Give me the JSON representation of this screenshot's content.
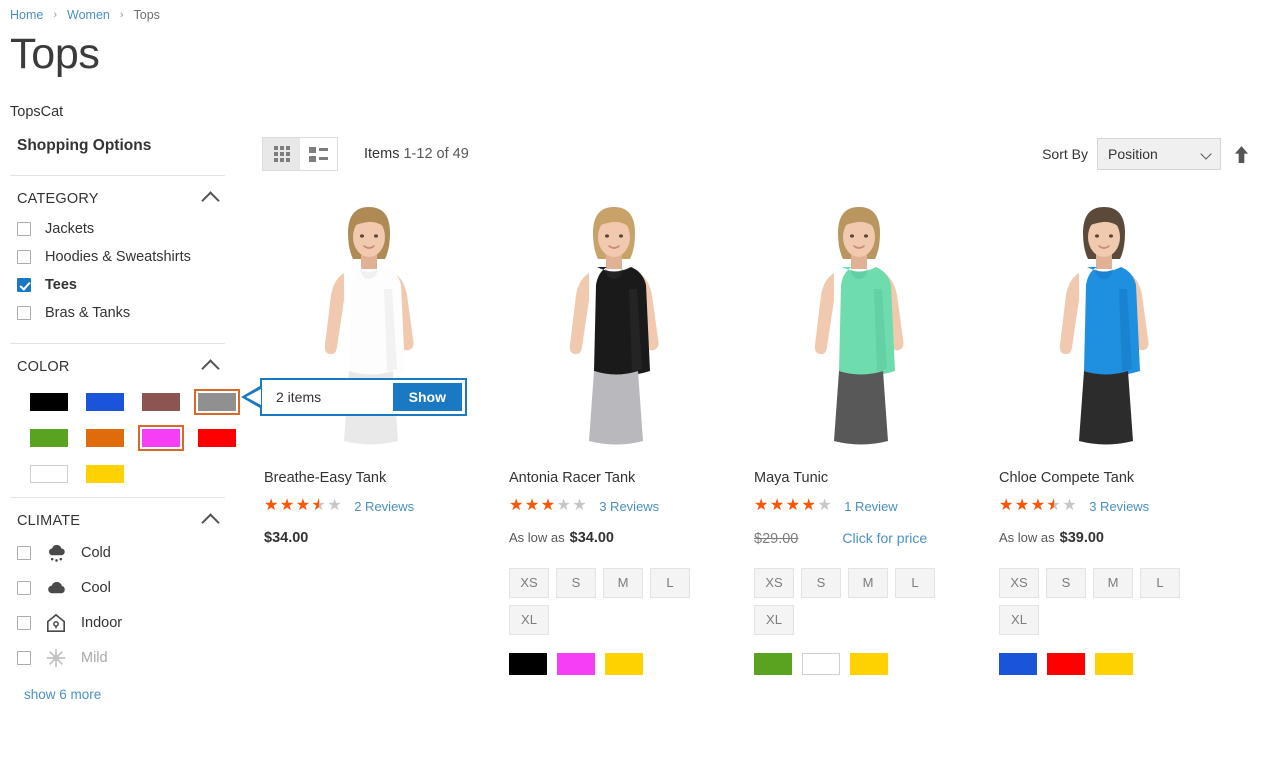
{
  "breadcrumb": {
    "items": [
      {
        "label": "Home",
        "type": "link"
      },
      {
        "label": "Women",
        "type": "link"
      },
      {
        "label": "Tops",
        "type": "current"
      }
    ],
    "separator": "›"
  },
  "page": {
    "title": "Tops",
    "description": "TopsCat"
  },
  "sidebar": {
    "title": "Shopping Options",
    "filters": [
      {
        "name": "category",
        "title": "CATEGORY",
        "type": "checkbox",
        "options": [
          {
            "label": "Jackets",
            "checked": false
          },
          {
            "label": "Hoodies & Sweatshirts",
            "checked": false
          },
          {
            "label": "Tees",
            "checked": true
          },
          {
            "label": "Bras & Tanks",
            "checked": false
          }
        ]
      },
      {
        "name": "color",
        "title": "COLOR",
        "type": "swatch",
        "options": [
          {
            "label": "Black",
            "hex": "#000000",
            "selected": false,
            "bordered": false
          },
          {
            "label": "Blue",
            "hex": "#1a54d8",
            "selected": false,
            "bordered": false
          },
          {
            "label": "Brown",
            "hex": "#8d5552",
            "selected": false,
            "bordered": false
          },
          {
            "label": "Gray",
            "hex": "#909090",
            "selected": true,
            "bordered": false
          },
          {
            "label": "Green",
            "hex": "#5aa320",
            "selected": false,
            "bordered": false
          },
          {
            "label": "Orange",
            "hex": "#e06b0a",
            "selected": false,
            "bordered": false
          },
          {
            "label": "Purple",
            "hex": "#f63ef6",
            "selected": true,
            "bordered": false
          },
          {
            "label": "Red",
            "hex": "#ff0000",
            "selected": false,
            "bordered": false
          },
          {
            "label": "White",
            "hex": "#ffffff",
            "selected": false,
            "bordered": true
          },
          {
            "label": "Yellow",
            "hex": "#fed100",
            "selected": false,
            "bordered": false
          }
        ]
      },
      {
        "name": "climate",
        "title": "CLIMATE",
        "type": "checkbox-icon",
        "options": [
          {
            "label": "Cold",
            "checked": false,
            "icon": "snow-cloud-icon",
            "muted": false
          },
          {
            "label": "Cool",
            "checked": false,
            "icon": "cloud-icon",
            "muted": false
          },
          {
            "label": "Indoor",
            "checked": false,
            "icon": "house-icon",
            "muted": false
          },
          {
            "label": "Mild",
            "checked": false,
            "icon": "sun-icon",
            "muted": true
          }
        ],
        "show_more": "show 6 more"
      }
    ]
  },
  "toolbar": {
    "view_modes": [
      {
        "name": "grid",
        "icon": "grid-view-icon",
        "active": true
      },
      {
        "name": "list",
        "icon": "list-view-icon",
        "active": false
      }
    ],
    "items_label": "Items",
    "items_range": "1-12 of 49",
    "sort_label": "Sort By",
    "sort_value": "Position",
    "sort_direction_icon": "arrow-up-icon"
  },
  "callout": {
    "text": "2 items",
    "button_label": "Show"
  },
  "products": [
    {
      "name": "Breathe-Easy Tank",
      "rating_percent": 70,
      "reviews": "2 Reviews",
      "price_prefix": "",
      "price": "$34.00",
      "old_price": "",
      "map_link": "",
      "image": "white-tank-model",
      "sizes": [],
      "colors": []
    },
    {
      "name": "Antonia Racer Tank",
      "rating_percent": 60,
      "reviews": "3 Reviews",
      "price_prefix": "As low as",
      "price": "$34.00",
      "old_price": "",
      "map_link": "",
      "image": "black-tank-model",
      "sizes": [
        "XS",
        "S",
        "M",
        "L",
        "XL"
      ],
      "colors": [
        {
          "label": "Black",
          "hex": "#000000",
          "bordered": false
        },
        {
          "label": "Purple",
          "hex": "#f63ef6",
          "bordered": false
        },
        {
          "label": "Yellow",
          "hex": "#fed100",
          "bordered": false
        }
      ]
    },
    {
      "name": "Maya Tunic",
      "rating_percent": 80,
      "reviews": "1 Review",
      "price_prefix": "",
      "price": "",
      "old_price": "$29.00",
      "map_link": "Click for price",
      "image": "green-tank-model",
      "sizes": [
        "XS",
        "S",
        "M",
        "L",
        "XL"
      ],
      "colors": [
        {
          "label": "Green",
          "hex": "#5aa320",
          "bordered": false
        },
        {
          "label": "White",
          "hex": "#ffffff",
          "bordered": true
        },
        {
          "label": "Yellow",
          "hex": "#fed100",
          "bordered": false
        }
      ]
    },
    {
      "name": "Chloe Compete Tank",
      "rating_percent": 70,
      "reviews": "3 Reviews",
      "price_prefix": "As low as",
      "price": "$39.00",
      "old_price": "",
      "map_link": "",
      "image": "blue-tank-model",
      "sizes": [
        "XS",
        "S",
        "M",
        "L",
        "XL"
      ],
      "colors": [
        {
          "label": "Blue",
          "hex": "#1a54d8",
          "bordered": false
        },
        {
          "label": "Red",
          "hex": "#ff0000",
          "bordered": false
        },
        {
          "label": "Yellow",
          "hex": "#fed100",
          "bordered": false
        }
      ]
    }
  ],
  "theme": {
    "link_blue": "#4a90c4",
    "accent_blue": "#1979c3",
    "star_orange": "#ff5501",
    "swatch_selected_border": "#d9682a"
  }
}
